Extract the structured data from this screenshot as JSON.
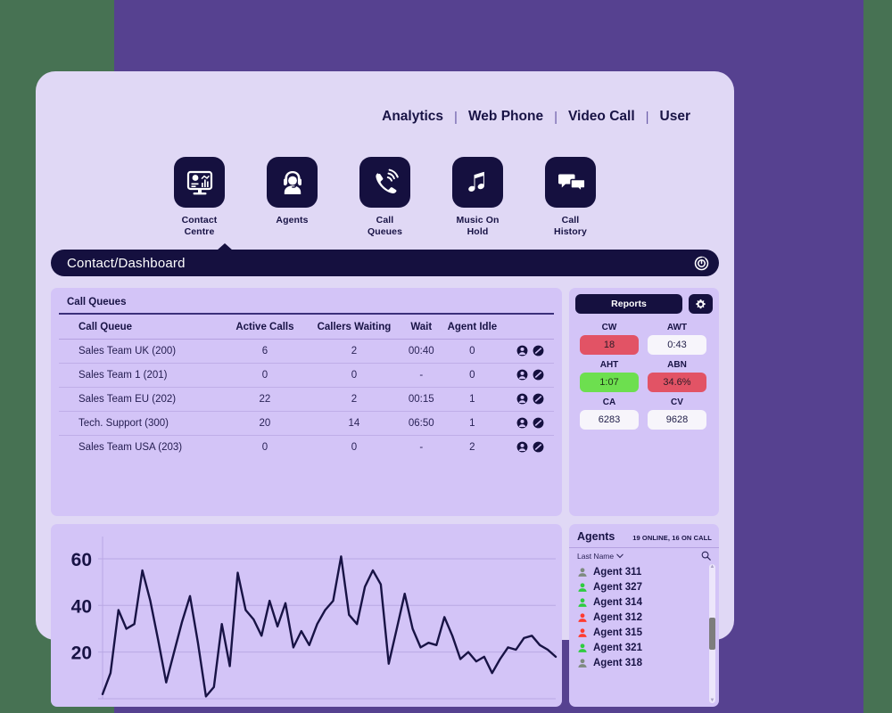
{
  "colors": {
    "page_background": "#477253",
    "accent_block": "#564190",
    "card": "#e0d8f5",
    "panel": "#d3c4f7",
    "dark_navy": "#15103f",
    "red": "#e25365",
    "green": "#6ddf4f",
    "white": "#f7f5fb",
    "agent_online": "#2ecc40",
    "agent_oncall": "#ff3b30",
    "agent_offline": "#7d8a7f"
  },
  "topnav": {
    "items": [
      {
        "label": "Analytics"
      },
      {
        "label": "Web Phone"
      },
      {
        "label": "Video Call"
      },
      {
        "label": "User"
      }
    ],
    "separator": "|"
  },
  "iconmenu": {
    "items": [
      {
        "label": "Contact\nCentre",
        "icon": "monitor-analytics-icon",
        "active": true
      },
      {
        "label": "Agents",
        "icon": "agent-headset-icon",
        "active": false
      },
      {
        "label": "Call\nQueues",
        "icon": "ringing-phone-icon",
        "active": false
      },
      {
        "label": "Music On\nHold",
        "icon": "music-note-icon",
        "active": false
      },
      {
        "label": "Call\nHistory",
        "icon": "chat-bubbles-icon",
        "active": false
      }
    ]
  },
  "breadcrumb": {
    "text": "Contact/Dashboard",
    "refresh_icon": "refresh-icon"
  },
  "queues": {
    "title": "Call Queues",
    "columns": [
      "Call Queue",
      "Active Calls",
      "Callers Waiting",
      "Wait",
      "Agent Idle",
      ""
    ],
    "rows": [
      {
        "name": "Sales Team UK (200)",
        "active_calls": "6",
        "callers_waiting": "2",
        "wait": "00:40",
        "agent_idle": "0"
      },
      {
        "name": "Sales Team 1 (201)",
        "active_calls": "0",
        "callers_waiting": "0",
        "wait": "-",
        "agent_idle": "0"
      },
      {
        "name": "Sales Team EU (202)",
        "active_calls": "22",
        "callers_waiting": "2",
        "wait": "00:15",
        "agent_idle": "1"
      },
      {
        "name": "Tech. Support (300)",
        "active_calls": "20",
        "callers_waiting": "14",
        "wait": "06:50",
        "agent_idle": "1"
      },
      {
        "name": "Sales Team USA (203)",
        "active_calls": "0",
        "callers_waiting": "0",
        "wait": "-",
        "agent_idle": "2"
      }
    ],
    "row_action_icons": [
      "user-icon",
      "no-entry-icon"
    ]
  },
  "reports": {
    "button_label": "Reports",
    "gear_icon": "gear-icon",
    "metrics": [
      {
        "label": "CW",
        "value": "18",
        "bg": "#e25365",
        "text": "#2b1b27"
      },
      {
        "label": "AWT",
        "value": "0:43",
        "bg": "#f7f5fb",
        "text": "#22204a"
      },
      {
        "label": "AHT",
        "value": "1:07",
        "bg": "#6ddf4f",
        "text": "#1e3216"
      },
      {
        "label": "ABN",
        "value": "34.6%",
        "bg": "#e25365",
        "text": "#2b1b27"
      },
      {
        "label": "CA",
        "value": "6283",
        "bg": "#f7f5fb",
        "text": "#22204a"
      },
      {
        "label": "CV",
        "value": "9628",
        "bg": "#f7f5fb",
        "text": "#22204a"
      }
    ]
  },
  "agents": {
    "title": "Agents",
    "status_summary": "19 ONLINE, 16 ON CALL",
    "sort_label": "Last Name",
    "sort_chevron": "chevron-down-icon",
    "search_icon": "search-icon",
    "list": [
      {
        "name": "Agent 311",
        "status": "offline"
      },
      {
        "name": "Agent 327",
        "status": "online"
      },
      {
        "name": "Agent 314",
        "status": "online"
      },
      {
        "name": "Agent 312",
        "status": "oncall"
      },
      {
        "name": "Agent 315",
        "status": "oncall"
      },
      {
        "name": "Agent 321",
        "status": "online"
      },
      {
        "name": "Agent 318",
        "status": "offline"
      }
    ]
  },
  "chart_data": {
    "type": "line",
    "title": "",
    "xlabel": "",
    "ylabel": "",
    "ylim": [
      0,
      68
    ],
    "yticks": [
      20,
      40,
      60
    ],
    "grid": true,
    "line_color": "#181345",
    "x": [
      0,
      1,
      2,
      3,
      4,
      5,
      6,
      7,
      8,
      9,
      10,
      11,
      12,
      13,
      14,
      15,
      16,
      17,
      18,
      19,
      20,
      21,
      22,
      23,
      24,
      25,
      26,
      27,
      28,
      29,
      30,
      31,
      32,
      33,
      34,
      35,
      36,
      37,
      38,
      39,
      40,
      41,
      42,
      43,
      44,
      45,
      46,
      47,
      48,
      49,
      50,
      51,
      52,
      53,
      54,
      55,
      56,
      57,
      58,
      59,
      60,
      61,
      62,
      63,
      64,
      65,
      66,
      67,
      68,
      69,
      70,
      71,
      72
    ],
    "values": [
      2,
      11,
      38,
      30,
      32,
      55,
      42,
      25,
      7,
      20,
      33,
      44,
      24,
      1,
      5,
      32,
      14,
      54,
      38,
      34,
      27,
      42,
      31,
      41,
      22,
      29,
      23,
      32,
      38,
      42,
      61,
      36,
      32,
      48,
      55,
      49,
      15,
      30,
      45,
      30,
      22,
      24,
      23,
      35,
      27,
      17,
      20,
      16,
      18,
      11,
      17,
      22,
      21,
      26,
      27,
      23,
      21,
      18
    ]
  }
}
